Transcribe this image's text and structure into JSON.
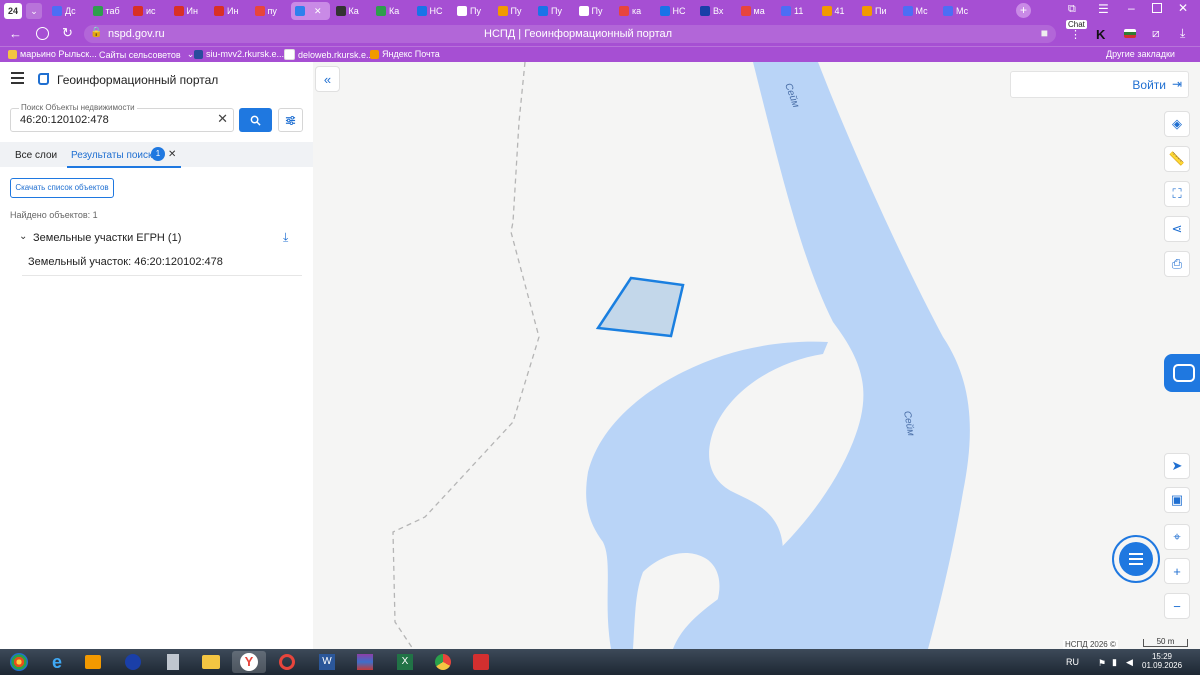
{
  "browser": {
    "tab_count": "24",
    "tabs": [
      {
        "label": "Дс",
        "color": "#4c6ef5"
      },
      {
        "label": "таб",
        "color": "#2e9e4d"
      },
      {
        "label": "ис",
        "color": "#d93025"
      },
      {
        "label": "Ин",
        "color": "#d93025"
      },
      {
        "label": "Ин",
        "color": "#d93025"
      },
      {
        "label": "пу",
        "color": "#e8453c"
      },
      {
        "label": "",
        "color": "#2f80ed"
      },
      {
        "label": "Ка",
        "color": "#333333"
      },
      {
        "label": "Ка",
        "color": "#2e9e4d"
      },
      {
        "label": "НС",
        "color": "#1a73e8"
      },
      {
        "label": "Пу",
        "color": "#ffffff"
      },
      {
        "label": "Пу",
        "color": "#f29900"
      },
      {
        "label": "Пу",
        "color": "#1a73e8"
      },
      {
        "label": "Пу",
        "color": "#ffffff"
      },
      {
        "label": "ка",
        "color": "#e8453c"
      },
      {
        "label": "НС",
        "color": "#1a73e8"
      },
      {
        "label": "Вх",
        "color": "#1a3fa8"
      },
      {
        "label": "ма",
        "color": "#e8453c"
      },
      {
        "label": "11",
        "color": "#4c6ef5"
      },
      {
        "label": "41",
        "color": "#f29900"
      },
      {
        "label": "Пи",
        "color": "#f29900"
      },
      {
        "label": "Мс",
        "color": "#4c6ef5"
      },
      {
        "label": "Мс",
        "color": "#4c6ef5"
      }
    ],
    "url": "nspd.gov.ru",
    "page_title": "НСПД | Геоинформационный портал",
    "chat_badge": "Chat",
    "bookmarks": [
      {
        "label": "марьино Рыльск..."
      },
      {
        "label": "Сайты сельсоветов"
      },
      {
        "label": "siu-mvv2.rkursk.e..."
      },
      {
        "label": "deloweb.rkursk.e..."
      },
      {
        "label": "Яндекс Почта"
      }
    ],
    "other_bookmarks": "Другие закладки"
  },
  "panel": {
    "portal_title": "Геоинформационный портал",
    "search_label": "Поиск Объекты недвижимости",
    "search_value": "46:20:120102:478",
    "tab_all_layers": "Все слои",
    "tab_results": "Результаты поиска",
    "results_count_badge": "1",
    "download_list_button": "Скачать список объектов",
    "found_count": "Найдено объектов: 1",
    "group_label": "Земельные участки ЕГРН (1)",
    "result_item": "Земельный участок: 46:20:120102:478"
  },
  "map": {
    "login_button": "Войти",
    "river_label_top": "Сейм",
    "river_label_mid": "Сейм",
    "attribution": "НСПД 2026 ©",
    "scale_label": "50 m",
    "water_color": "#b9d4f7",
    "parcel_stroke": "#1a7fe0"
  },
  "taskbar": {
    "lang": "RU",
    "time": "15:29",
    "date": "01.09.2026"
  }
}
